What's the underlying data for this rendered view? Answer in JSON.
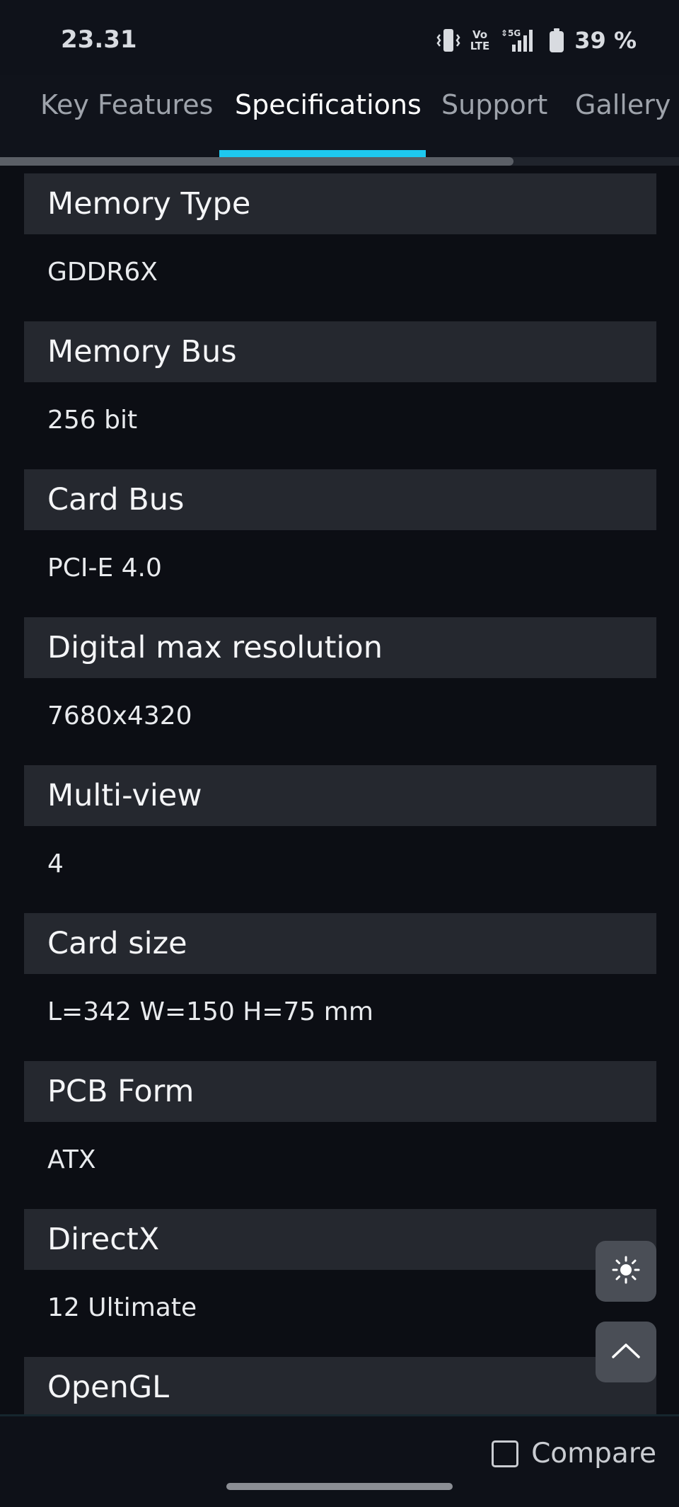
{
  "status_bar": {
    "time": "23.31",
    "network": "5G",
    "volte": "Vo\nLTE",
    "battery": "39 %"
  },
  "tabs": [
    {
      "label": "Key Features",
      "active": false
    },
    {
      "label": "Specifications",
      "active": true
    },
    {
      "label": "Support",
      "active": false
    },
    {
      "label": "Gallery",
      "active": false
    }
  ],
  "specs": [
    {
      "name": "Memory Type",
      "value": "GDDR6X"
    },
    {
      "name": "Memory Bus",
      "value": "256 bit"
    },
    {
      "name": "Card Bus",
      "value": "PCI-E 4.0"
    },
    {
      "name": "Digital max resolution",
      "value": "7680x4320"
    },
    {
      "name": "Multi-view",
      "value": "4"
    },
    {
      "name": "Card size",
      "value": "L=342 W=150 H=75 mm"
    },
    {
      "name": "PCB Form",
      "value": "ATX"
    },
    {
      "name": "DirectX",
      "value": "12 Ultimate"
    },
    {
      "name": "OpenGL",
      "value": ""
    }
  ],
  "floating": {
    "theme_icon": "sun-icon",
    "top_icon": "chevron-up-icon"
  },
  "compare": {
    "label": "Compare",
    "checked": false
  },
  "colors": {
    "accent": "#1ec8ef",
    "background": "#0c0e14",
    "header_bg": "#25282f"
  }
}
